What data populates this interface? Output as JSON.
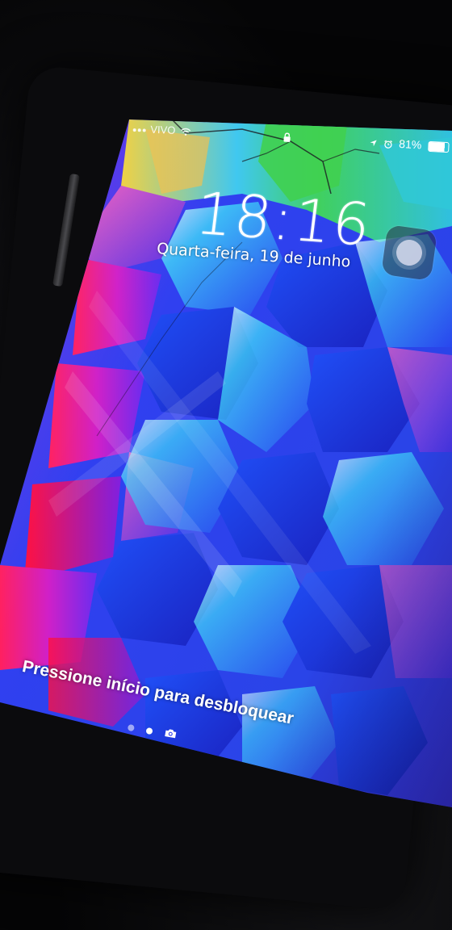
{
  "lock_screen": {
    "carrier": "VIVO",
    "battery_text": "81%",
    "battery_level": 0.81,
    "time": "18:16",
    "date": "Quarta-feira, 19 de junho",
    "unlock_hint": "Pressione início para desbloquear",
    "page_indicator": {
      "pages": 2,
      "current": 2
    }
  },
  "icons": {
    "lock": "lock-icon",
    "wifi": "wifi-icon",
    "location": "location-arrow-icon",
    "alarm": "alarm-clock-icon",
    "camera": "camera-icon",
    "assistive_touch": "assistive-touch-icon"
  },
  "colors": {
    "wallpaper_blue": "#2f3ff0",
    "wallpaper_magenta": "#d020c8",
    "wallpaper_cyan": "#20c8f0",
    "wallpaper_green": "#40d060",
    "phone_frame": "#0b0b0d",
    "text": "#ffffff"
  }
}
